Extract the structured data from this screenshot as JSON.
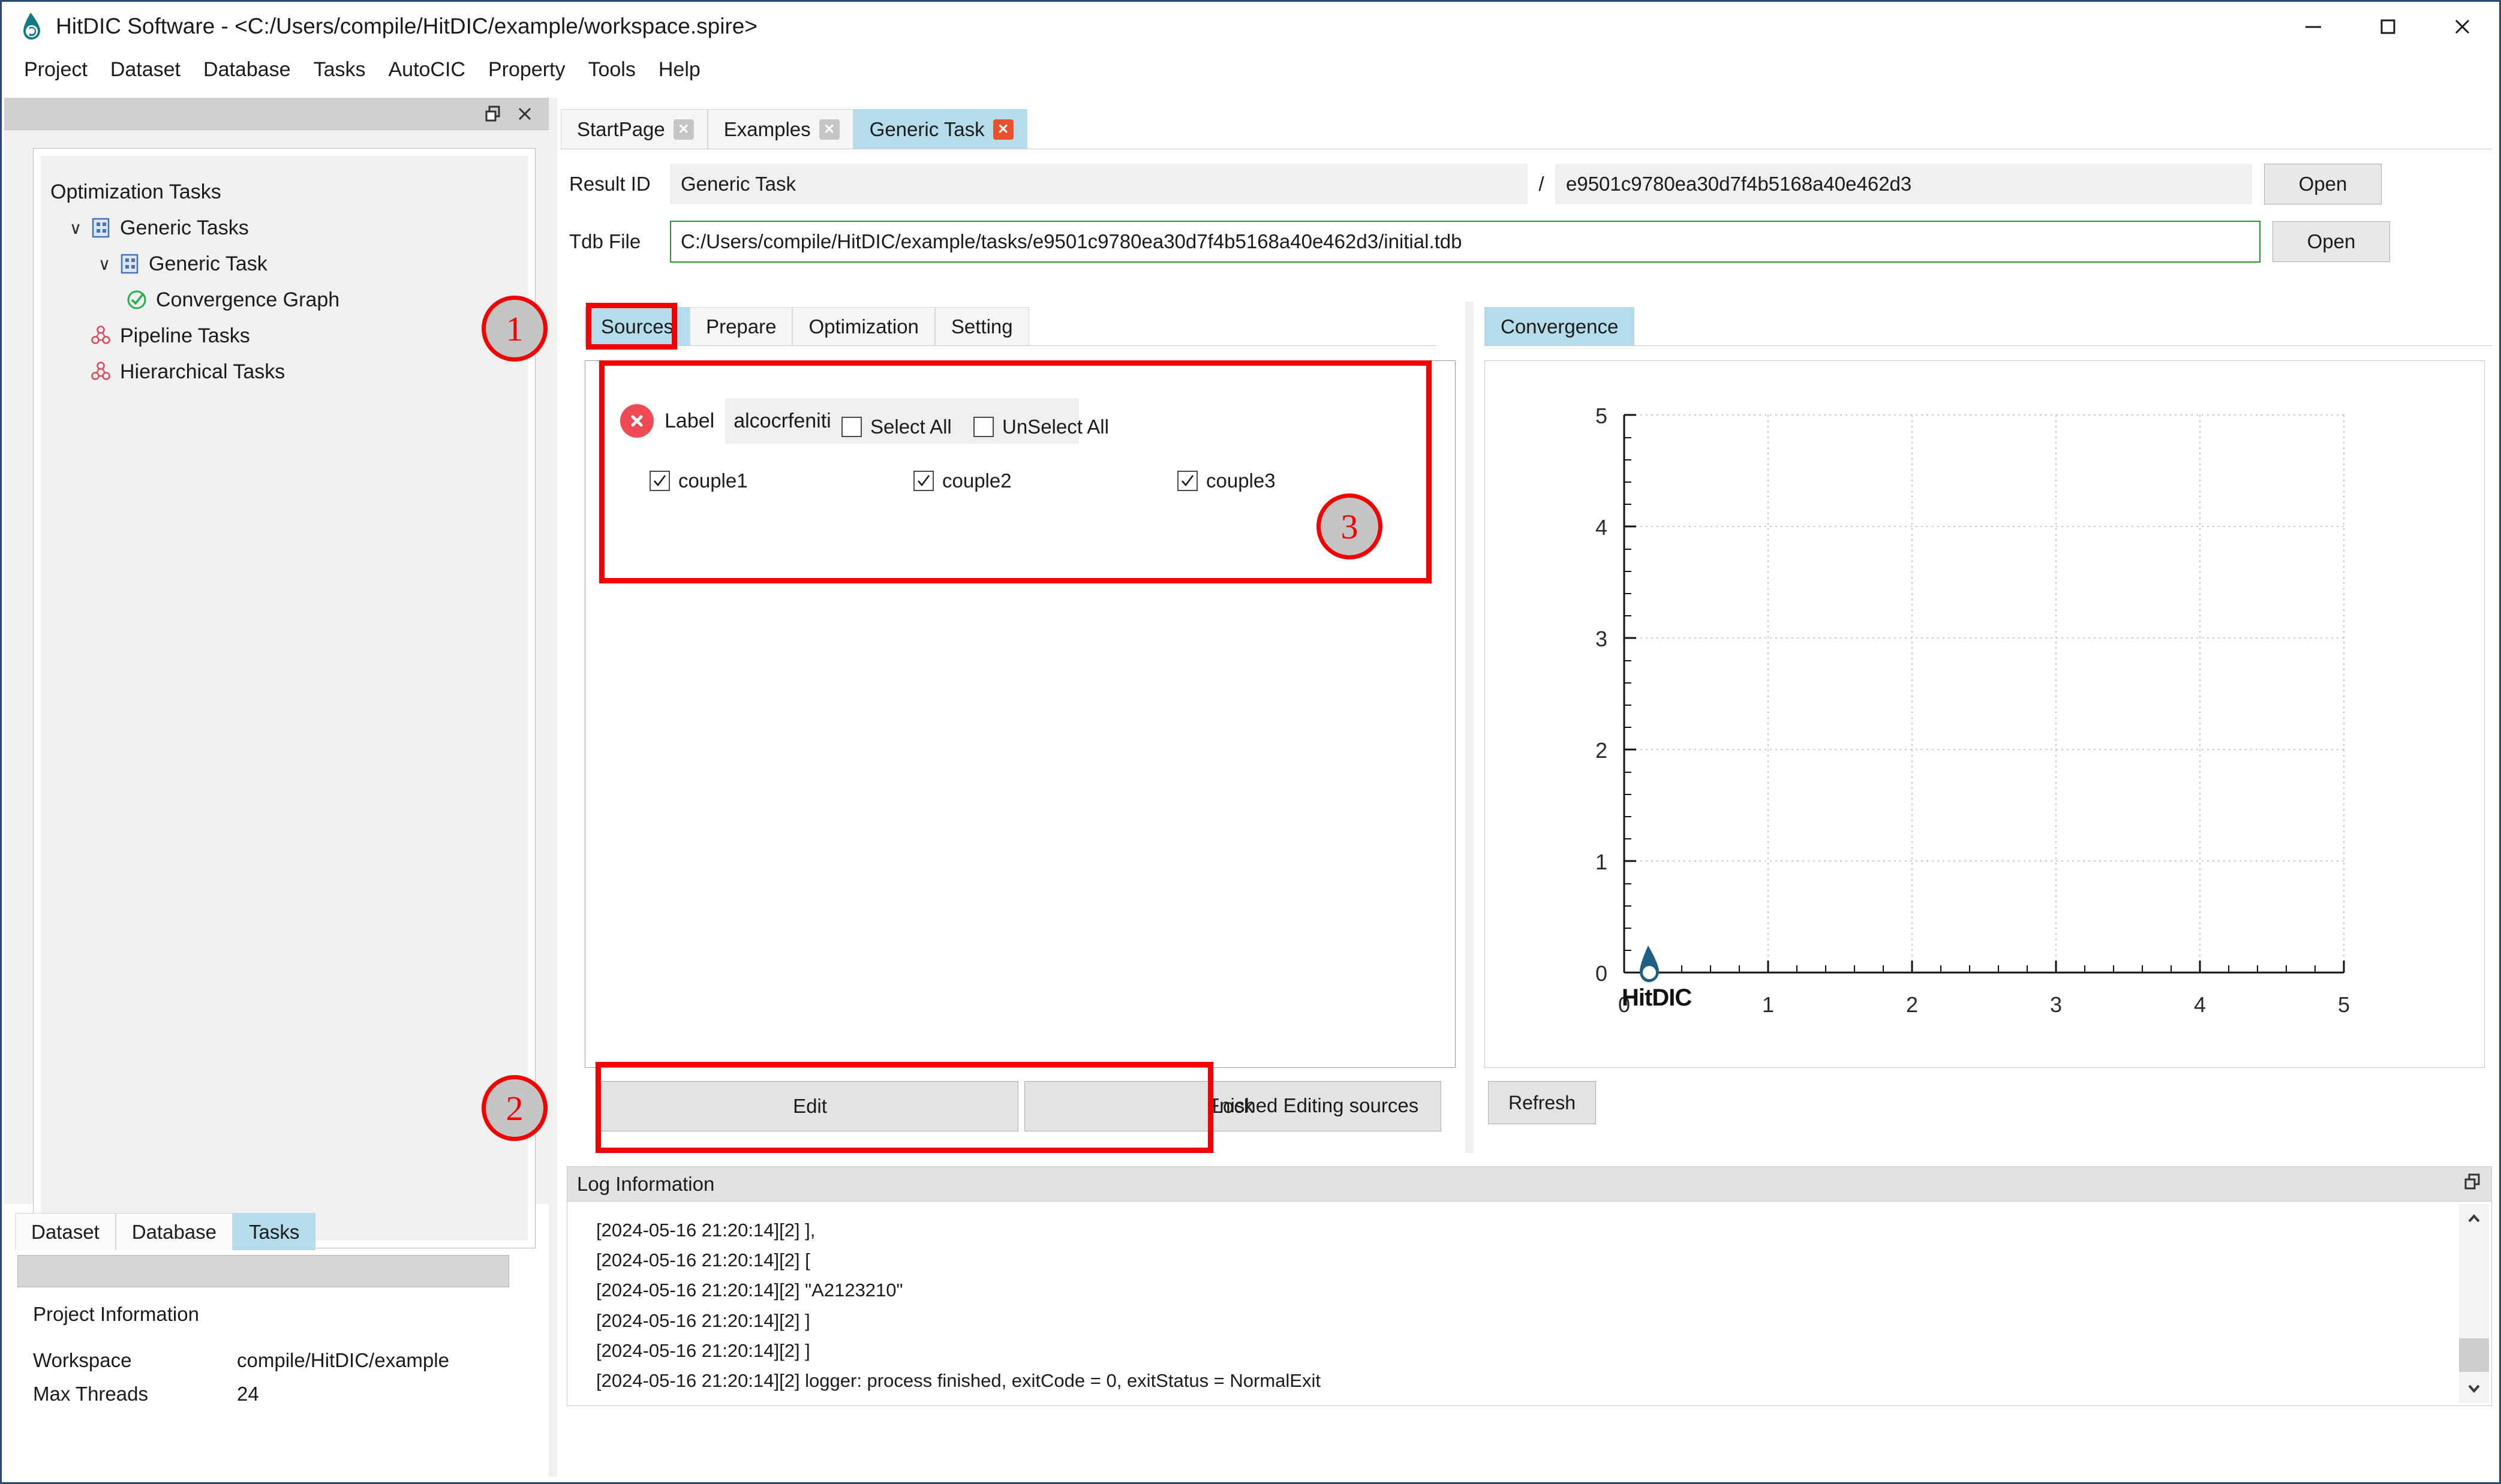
{
  "window": {
    "title": "HitDIC Software - <C:/Users/compile/HitDIC/example/workspace.spire>",
    "icon": "app-droplet-icon",
    "controls": {
      "minimize": "minimize-icon",
      "maximize": "maximize-icon",
      "close": "close-icon"
    }
  },
  "menubar": {
    "items": [
      "Project",
      "Dataset",
      "Database",
      "Tasks",
      "AutoCIC",
      "Property",
      "Tools",
      "Help"
    ]
  },
  "left_dock": {
    "header_buttons": [
      "restore-icon",
      "close-icon"
    ],
    "tree": {
      "root_label": "Optimization Tasks",
      "items": [
        {
          "label": "Generic Tasks",
          "indent": 1,
          "chevron": "∨",
          "icon": "task-grid-icon"
        },
        {
          "label": "Generic Task",
          "indent": 2,
          "chevron": "∨",
          "icon": "task-grid-icon"
        },
        {
          "label": "Convergence Graph",
          "indent": 3,
          "chevron": "",
          "icon": "check-circle-icon"
        },
        {
          "label": "Pipeline Tasks",
          "indent": 1,
          "chevron": "",
          "icon": "pipeline-icon"
        },
        {
          "label": "Hierarchical Tasks",
          "indent": 1,
          "chevron": "",
          "icon": "pipeline-icon"
        }
      ]
    },
    "tabs": [
      {
        "label": "Dataset",
        "active": false
      },
      {
        "label": "Database",
        "active": false
      },
      {
        "label": "Tasks",
        "active": true
      }
    ],
    "search_value": "",
    "project_info": {
      "title": "Project Information",
      "rows": [
        {
          "key": "Workspace",
          "value": "compile/HitDIC/example"
        },
        {
          "key": "Max Threads",
          "value": "24"
        }
      ]
    }
  },
  "main": {
    "tabs": [
      {
        "label": "StartPage",
        "active": false,
        "close": "close-icon"
      },
      {
        "label": "Examples",
        "active": false,
        "close": "close-icon"
      },
      {
        "label": "Generic Task",
        "active": true,
        "close": "close-icon"
      }
    ],
    "result_id": {
      "label": "Result ID",
      "name_value": "Generic Task",
      "separator": "/",
      "hash_value": "e9501c9780ea30d7f4b5168a40e462d3",
      "open_label": "Open"
    },
    "tdb_file": {
      "label": "Tdb File",
      "value": "C:/Users/compile/HitDIC/example/tasks/e9501c9780ea30d7f4b5168a40e462d3/initial.tdb",
      "open_label": "Open"
    },
    "sub_tabs": [
      {
        "label": "Sources",
        "active": true
      },
      {
        "label": "Prepare",
        "active": false
      },
      {
        "label": "Optimization",
        "active": false
      },
      {
        "label": "Setting",
        "active": false
      }
    ],
    "sources": {
      "status_icon": "error-x-icon",
      "label_caption": "Label",
      "label_value": "alcocrfeniti",
      "select_all": {
        "label": "Select All",
        "checked": false
      },
      "unselect_all": {
        "label": "UnSelect All",
        "checked": false
      },
      "couples": [
        {
          "label": "couple1",
          "checked": true
        },
        {
          "label": "couple2",
          "checked": true
        },
        {
          "label": "couple3",
          "checked": true
        }
      ],
      "edit_label": "Edit",
      "lock_label": "Lock",
      "status_text": "Fnished Editing sources"
    }
  },
  "convergence": {
    "tab_label": "Convergence",
    "refresh_label": "Refresh",
    "watermark": "HitDIC"
  },
  "chart_data": {
    "type": "line",
    "title": "Convergence",
    "xlabel": "",
    "ylabel": "",
    "xlim": [
      0,
      5
    ],
    "ylim": [
      0,
      5
    ],
    "xticks": [
      0,
      1,
      2,
      3,
      4,
      5
    ],
    "yticks": [
      0,
      1,
      2,
      3,
      4,
      5
    ],
    "xtick_labels": [
      "0",
      "1",
      "2",
      "3",
      "4",
      "5"
    ],
    "ytick_labels": [
      "0",
      "1",
      "2",
      "3",
      "4",
      "5"
    ],
    "grid": true,
    "legend": null,
    "series": [
      {
        "name": "convergence",
        "x": [],
        "y": []
      }
    ],
    "annotations": [
      "HitDIC"
    ]
  },
  "log": {
    "header": "Log Information",
    "restore_icon": "restore-icon",
    "lines": [
      "[2024-05-16 21:20:14][2] ],",
      "[2024-05-16 21:20:14][2] [",
      "[2024-05-16 21:20:14][2] \"A2123210\"",
      "[2024-05-16 21:20:14][2] ]",
      "[2024-05-16 21:20:14][2] ]",
      "[2024-05-16 21:20:14][2] logger: process finished, exitCode = 0, exitStatus = NormalExit"
    ],
    "scroll_up": "chevron-up-icon",
    "scroll_down": "chevron-down-icon"
  },
  "annotations": {
    "markers": [
      {
        "number": "1"
      },
      {
        "number": "2"
      },
      {
        "number": "3"
      }
    ],
    "color": "#f40000"
  }
}
